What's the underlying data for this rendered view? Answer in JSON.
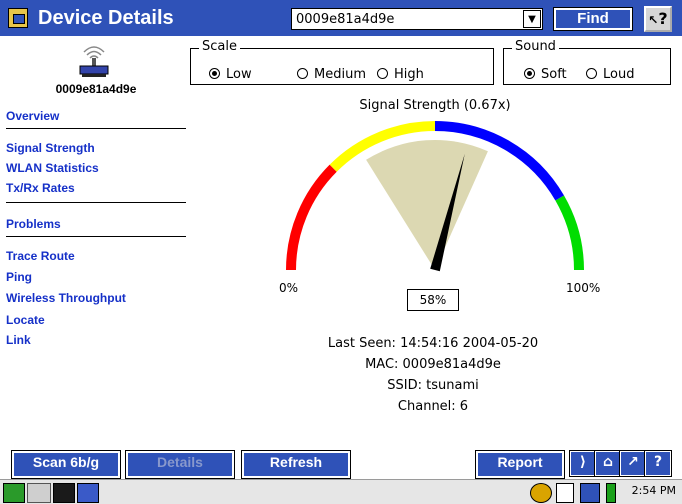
{
  "window": {
    "title": "Device Details"
  },
  "header": {
    "device_selected": "0009e81a4d9e",
    "find_label": "Find",
    "help_label": "?"
  },
  "sidebar": {
    "device_name": "0009e81a4d9e",
    "items": [
      {
        "label": "Overview"
      },
      {
        "label": "Signal Strength"
      },
      {
        "label": "WLAN Statistics"
      },
      {
        "label": "Tx/Rx Rates"
      },
      {
        "label": "Problems"
      },
      {
        "label": "Trace Route"
      },
      {
        "label": "Ping"
      },
      {
        "label": "Wireless Throughput"
      },
      {
        "label": "Locate"
      },
      {
        "label": "Link"
      }
    ]
  },
  "scale": {
    "label": "Scale",
    "options": [
      "Low",
      "Medium",
      "High"
    ],
    "selected": "Low"
  },
  "sound": {
    "label": "Sound",
    "options": [
      "Soft",
      "Loud"
    ],
    "selected": "Soft"
  },
  "gauge": {
    "title": "Signal Strength (0.67x)",
    "min_label": "0%",
    "max_label": "100%",
    "value_text": "58%",
    "value_percent": 58,
    "colors": {
      "red": "#ff0000",
      "yellow": "#ffff00",
      "blue": "#0000ff",
      "green": "#00dd00",
      "wedge": "#dcd8b2"
    }
  },
  "info": {
    "last_seen": "Last Seen: 14:54:16 2004-05-20",
    "mac": "MAC: 0009e81a4d9e",
    "ssid": "SSID: tsunami",
    "channel": "Channel: 6"
  },
  "buttons": {
    "scan": "Scan 6b/g",
    "details": "Details",
    "refresh": "Refresh",
    "report": "Report"
  },
  "taskbar": {
    "clock": "2:54 PM"
  },
  "theme": {
    "accent": "#2f52b8",
    "link": "#1530c8"
  }
}
